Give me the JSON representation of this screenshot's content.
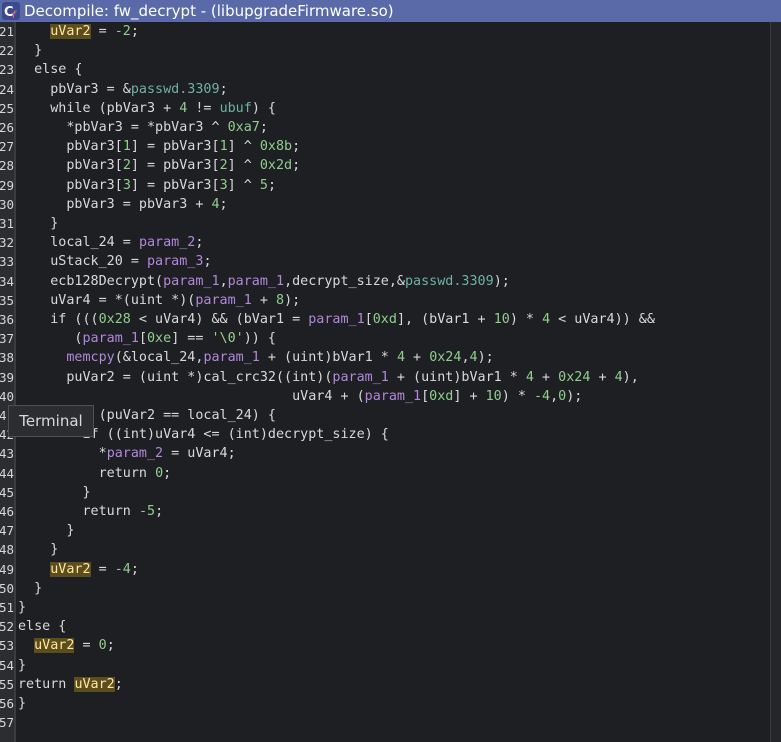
{
  "window": {
    "title": "Decompile: fw_decrypt -  (libupgradeFirmware.so)",
    "icon_letters": "Cf"
  },
  "tooltip": {
    "label": "Terminal"
  },
  "colors": {
    "titlebar": "#5a6aa8",
    "background": "#1e1f22",
    "highlight": "#5c4d1f"
  },
  "lines": [
    {
      "n": "21",
      "segs": [
        {
          "t": "    "
        },
        {
          "t": "uVar2",
          "c": "hl"
        },
        {
          "t": " = "
        },
        {
          "t": "-2",
          "c": "num"
        },
        {
          "t": ";"
        }
      ]
    },
    {
      "n": "22",
      "segs": [
        {
          "t": "  }"
        }
      ]
    },
    {
      "n": "23",
      "segs": [
        {
          "t": "  else {"
        }
      ]
    },
    {
      "n": "24",
      "segs": [
        {
          "t": "    pbVar3 = &"
        },
        {
          "t": "passwd.3309",
          "c": "glob"
        },
        {
          "t": ";"
        }
      ]
    },
    {
      "n": "25",
      "segs": [
        {
          "t": "    while (pbVar3 + "
        },
        {
          "t": "4",
          "c": "num"
        },
        {
          "t": " != "
        },
        {
          "t": "ubuf",
          "c": "glob"
        },
        {
          "t": ") {"
        }
      ]
    },
    {
      "n": "26",
      "segs": [
        {
          "t": "      *pbVar3 = *pbVar3 ^ "
        },
        {
          "t": "0xa7",
          "c": "num"
        },
        {
          "t": ";"
        }
      ]
    },
    {
      "n": "27",
      "segs": [
        {
          "t": "      pbVar3["
        },
        {
          "t": "1",
          "c": "num"
        },
        {
          "t": "] = pbVar3["
        },
        {
          "t": "1",
          "c": "num"
        },
        {
          "t": "] ^ "
        },
        {
          "t": "0x8b",
          "c": "num"
        },
        {
          "t": ";"
        }
      ]
    },
    {
      "n": "28",
      "segs": [
        {
          "t": "      pbVar3["
        },
        {
          "t": "2",
          "c": "num"
        },
        {
          "t": "] = pbVar3["
        },
        {
          "t": "2",
          "c": "num"
        },
        {
          "t": "] ^ "
        },
        {
          "t": "0x2d",
          "c": "num"
        },
        {
          "t": ";"
        }
      ]
    },
    {
      "n": "29",
      "segs": [
        {
          "t": "      pbVar3["
        },
        {
          "t": "3",
          "c": "num"
        },
        {
          "t": "] = pbVar3["
        },
        {
          "t": "3",
          "c": "num"
        },
        {
          "t": "] ^ "
        },
        {
          "t": "5",
          "c": "num"
        },
        {
          "t": ";"
        }
      ]
    },
    {
      "n": "30",
      "segs": [
        {
          "t": "      pbVar3 = pbVar3 + "
        },
        {
          "t": "4",
          "c": "num"
        },
        {
          "t": ";"
        }
      ]
    },
    {
      "n": "31",
      "segs": [
        {
          "t": "    }"
        }
      ]
    },
    {
      "n": "32",
      "segs": [
        {
          "t": "    local_24 = "
        },
        {
          "t": "param_2",
          "c": "param"
        },
        {
          "t": ";"
        }
      ]
    },
    {
      "n": "33",
      "segs": [
        {
          "t": "    uStack_20 = "
        },
        {
          "t": "param_3",
          "c": "param"
        },
        {
          "t": ";"
        }
      ]
    },
    {
      "n": "34",
      "segs": [
        {
          "t": "    ecb128Decrypt("
        },
        {
          "t": "param_1",
          "c": "param"
        },
        {
          "t": ","
        },
        {
          "t": "param_1",
          "c": "param"
        },
        {
          "t": ",decrypt_size,&"
        },
        {
          "t": "passwd.3309",
          "c": "glob"
        },
        {
          "t": ");"
        }
      ]
    },
    {
      "n": "35",
      "segs": [
        {
          "t": "    uVar4 = *(uint *)("
        },
        {
          "t": "param_1",
          "c": "param"
        },
        {
          "t": " + "
        },
        {
          "t": "8",
          "c": "num"
        },
        {
          "t": ");"
        }
      ]
    },
    {
      "n": "36",
      "segs": [
        {
          "t": "    if ((("
        },
        {
          "t": "0x28",
          "c": "num"
        },
        {
          "t": " < uVar4) && (bVar1 = "
        },
        {
          "t": "param_1",
          "c": "param"
        },
        {
          "t": "["
        },
        {
          "t": "0xd",
          "c": "num"
        },
        {
          "t": "], (bVar1 + "
        },
        {
          "t": "10",
          "c": "num"
        },
        {
          "t": ") * "
        },
        {
          "t": "4",
          "c": "num"
        },
        {
          "t": " < uVar4)) &&"
        }
      ]
    },
    {
      "n": "37",
      "segs": [
        {
          "t": "       ("
        },
        {
          "t": "param_1",
          "c": "param"
        },
        {
          "t": "["
        },
        {
          "t": "0xe",
          "c": "num"
        },
        {
          "t": "] == "
        },
        {
          "t": "'\\0'",
          "c": "str"
        },
        {
          "t": ")) {"
        }
      ]
    },
    {
      "n": "38",
      "segs": [
        {
          "t": "      "
        },
        {
          "t": "memcpy",
          "c": "fn"
        },
        {
          "t": "(&local_24,"
        },
        {
          "t": "param_1",
          "c": "param"
        },
        {
          "t": " + (uint)bVar1 * "
        },
        {
          "t": "4",
          "c": "num"
        },
        {
          "t": " + "
        },
        {
          "t": "0x24",
          "c": "num"
        },
        {
          "t": ","
        },
        {
          "t": "4",
          "c": "num"
        },
        {
          "t": ");"
        }
      ]
    },
    {
      "n": "39",
      "segs": [
        {
          "t": "      puVar2 = (uint *)cal_crc32((int)("
        },
        {
          "t": "param_1",
          "c": "param"
        },
        {
          "t": " + (uint)bVar1 * "
        },
        {
          "t": "4",
          "c": "num"
        },
        {
          "t": " + "
        },
        {
          "t": "0x24",
          "c": "num"
        },
        {
          "t": " + "
        },
        {
          "t": "4",
          "c": "num"
        },
        {
          "t": "),"
        }
      ]
    },
    {
      "n": "40",
      "segs": [
        {
          "t": "                                  uVar4 + ("
        },
        {
          "t": "param_1",
          "c": "param"
        },
        {
          "t": "["
        },
        {
          "t": "0xd",
          "c": "num"
        },
        {
          "t": "] + "
        },
        {
          "t": "10",
          "c": "num"
        },
        {
          "t": ") * "
        },
        {
          "t": "-4",
          "c": "num"
        },
        {
          "t": ","
        },
        {
          "t": "0",
          "c": "num"
        },
        {
          "t": ");"
        }
      ]
    },
    {
      "n": "41",
      "segs": [
        {
          "t": "       if (puVar2 == local_24) {"
        }
      ]
    },
    {
      "n": "42",
      "segs": [
        {
          "t": "        if ((int)uVar4 <= (int)decrypt_size) {"
        }
      ]
    },
    {
      "n": "43",
      "segs": [
        {
          "t": "          *"
        },
        {
          "t": "param_2",
          "c": "param"
        },
        {
          "t": " = uVar4;"
        }
      ]
    },
    {
      "n": "44",
      "segs": [
        {
          "t": "          return "
        },
        {
          "t": "0",
          "c": "num"
        },
        {
          "t": ";"
        }
      ]
    },
    {
      "n": "45",
      "segs": [
        {
          "t": "        }"
        }
      ]
    },
    {
      "n": "46",
      "segs": [
        {
          "t": "        return "
        },
        {
          "t": "-5",
          "c": "num"
        },
        {
          "t": ";"
        }
      ]
    },
    {
      "n": "47",
      "segs": [
        {
          "t": "      }"
        }
      ]
    },
    {
      "n": "48",
      "segs": [
        {
          "t": "    }"
        }
      ]
    },
    {
      "n": "49",
      "segs": [
        {
          "t": "    "
        },
        {
          "t": "uVar2",
          "c": "hl"
        },
        {
          "t": " = "
        },
        {
          "t": "-4",
          "c": "num"
        },
        {
          "t": ";"
        }
      ]
    },
    {
      "n": "50",
      "segs": [
        {
          "t": "  }"
        }
      ]
    },
    {
      "n": "51",
      "segs": [
        {
          "t": "}"
        }
      ]
    },
    {
      "n": "52",
      "segs": [
        {
          "t": "else {"
        }
      ]
    },
    {
      "n": "53",
      "segs": [
        {
          "t": "  "
        },
        {
          "t": "uVar2",
          "c": "hl"
        },
        {
          "t": " = "
        },
        {
          "t": "0",
          "c": "num"
        },
        {
          "t": ";"
        }
      ]
    },
    {
      "n": "54",
      "segs": [
        {
          "t": "}"
        }
      ]
    },
    {
      "n": "55",
      "segs": [
        {
          "t": "return "
        },
        {
          "t": "uVar2",
          "c": "hl"
        },
        {
          "t": ";"
        }
      ]
    },
    {
      "n": "56",
      "segs": [
        {
          "t": "}"
        }
      ]
    },
    {
      "n": "57",
      "segs": []
    }
  ]
}
